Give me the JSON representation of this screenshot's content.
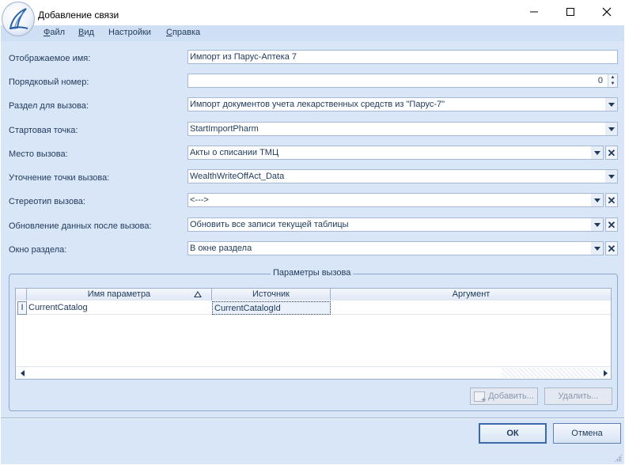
{
  "window": {
    "title": "Добавление связи"
  },
  "menu": {
    "items": [
      {
        "hotkey": "Ф",
        "rest": "айл"
      },
      {
        "hotkey": "В",
        "rest": "ид"
      },
      {
        "hotkey": "",
        "rest": "Настройки"
      },
      {
        "hotkey": "С",
        "rest": "правка"
      }
    ]
  },
  "form": {
    "display_name": {
      "label": "Отображаемое имя:",
      "value": "Импорт из Парус-Аптека 7"
    },
    "order_number": {
      "label": "Порядковый номер:",
      "value": "0"
    },
    "section": {
      "label": "Раздел для вызова:",
      "value": "Импорт документов учета лекарственных средств из \"Парус-7\""
    },
    "start_point": {
      "label": "Стартовая точка:",
      "value": "StartImportPharm"
    },
    "call_place": {
      "label": "Место вызова:",
      "value": "Акты о списании ТМЦ"
    },
    "call_point_detail": {
      "label": "Уточнение точки вызова:",
      "value": "WealthWriteOffAct_Data"
    },
    "stereotype": {
      "label": "Стереотип вызова:",
      "value": "<--->"
    },
    "refresh_after": {
      "label": "Обновление данных после вызова:",
      "value": "Обновить все записи текущей таблицы"
    },
    "section_window": {
      "label": "Окно раздела:",
      "value": "В окне раздела"
    }
  },
  "params": {
    "group_title": "Параметры вызова",
    "columns": [
      "Имя параметра",
      "Источник",
      "Аргумент"
    ],
    "rows": [
      {
        "marker": "I",
        "name": "CurrentCatalog",
        "source": "CurrentCatalogId",
        "argument": ""
      }
    ],
    "add_label": "Добавить...",
    "delete_label": "Удалить..."
  },
  "dialog": {
    "ok_label": "ОК",
    "cancel_label": "Отмена"
  },
  "colors": {
    "client_bg": "#d9e6f7",
    "text": "#1e395b",
    "border": "#a5b9d5"
  }
}
